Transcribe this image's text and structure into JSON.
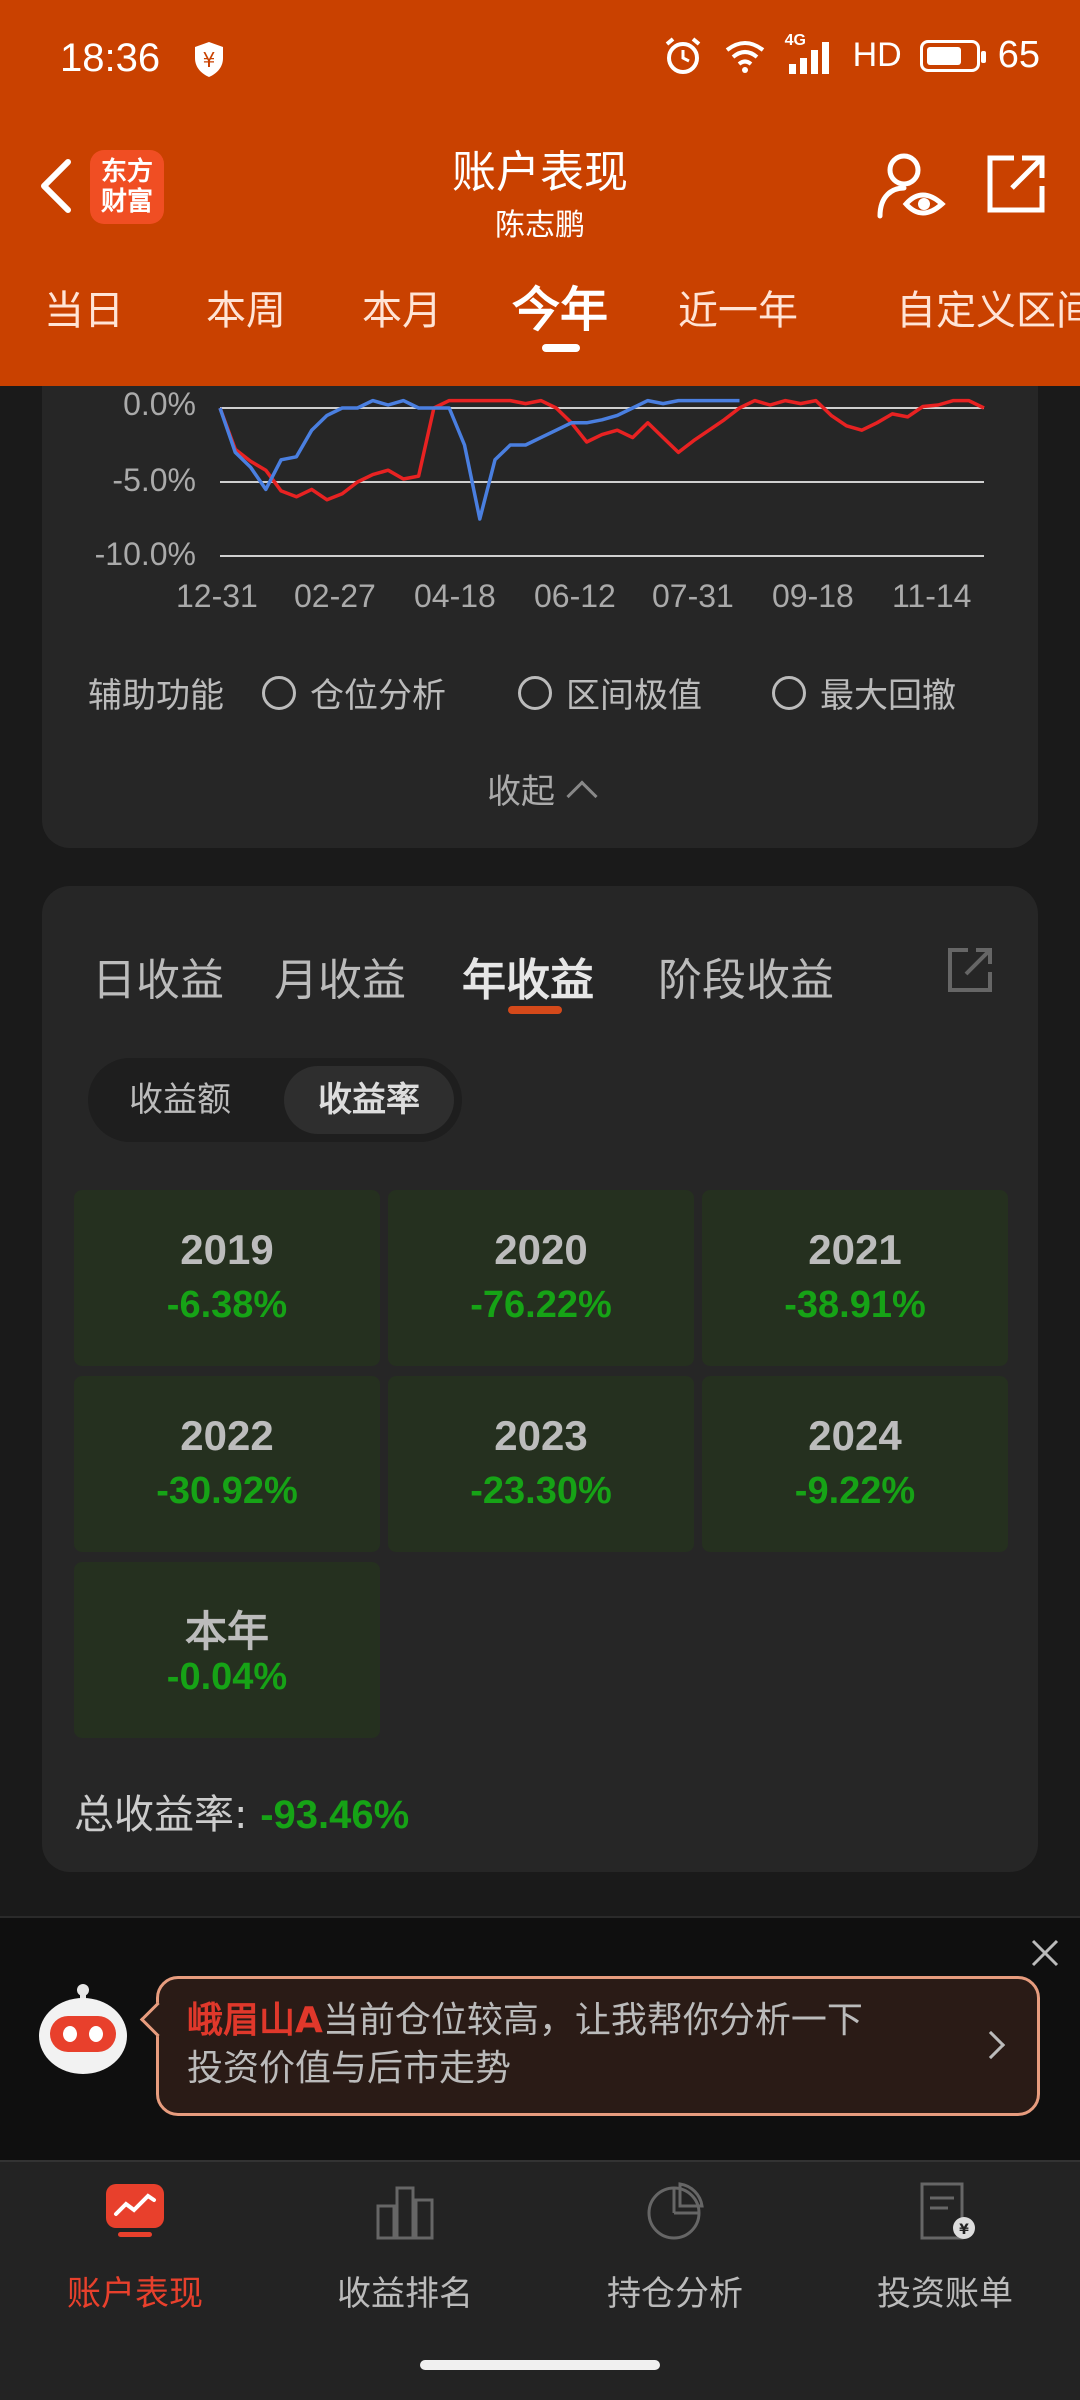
{
  "status_bar": {
    "time": "18:36",
    "network": "4G",
    "hd": "HD",
    "battery": "65"
  },
  "header": {
    "title": "账户表现",
    "subtitle": "陈志鹏",
    "logo": [
      "东方",
      "财富"
    ]
  },
  "period_tabs": [
    "当日",
    "本周",
    "本月",
    "今年",
    "近一年",
    "自定义区间"
  ],
  "period_active": "今年",
  "chart_data": {
    "type": "line",
    "title": "",
    "x_ticks": [
      "12-31",
      "02-27",
      "04-18",
      "06-12",
      "07-31",
      "09-18",
      "11-14"
    ],
    "y_ticks": [
      "0.0%",
      "-5.0%",
      "-10.0%"
    ],
    "ylim": [
      -10,
      0
    ],
    "series": [
      {
        "color": "#e82222",
        "x": [
          0,
          2,
          4,
          6,
          8,
          10,
          12,
          14,
          16,
          18,
          20,
          22,
          24,
          26,
          28,
          30,
          32,
          34,
          36,
          38,
          40,
          42,
          44,
          46,
          48,
          50,
          52,
          54,
          56,
          58,
          60,
          62,
          64,
          66,
          68,
          70,
          72,
          74,
          76,
          78,
          80,
          82,
          84,
          86,
          88,
          90,
          92,
          94,
          96,
          98,
          100
        ],
        "y": [
          0,
          -2.8,
          -3.6,
          -4.2,
          -5.6,
          -6.0,
          -5.5,
          -6.2,
          -5.8,
          -5.0,
          -4.5,
          -4.2,
          -4.8,
          -4.6,
          0,
          0.5,
          0.5,
          0.5,
          0.5,
          0.5,
          0.3,
          0.5,
          0,
          -1.0,
          -2.3,
          -1.8,
          -1.5,
          -2.0,
          -1.0,
          -2.0,
          -3.0,
          -2.2,
          -1.5,
          -0.8,
          0,
          0.5,
          0.2,
          0.5,
          0.3,
          0.5,
          -0.5,
          -1.2,
          -1.5,
          -1.0,
          -0.4,
          -0.6,
          0.1,
          0.2,
          0.5,
          0.5,
          0
        ]
      },
      {
        "color": "#4a7fe0",
        "x": [
          0,
          2,
          4,
          6,
          8,
          10,
          12,
          14,
          16,
          18,
          20,
          22,
          24,
          26,
          28,
          30,
          32,
          34,
          36,
          38,
          40,
          42,
          44,
          46,
          48,
          50,
          52,
          54,
          56,
          58,
          60,
          62,
          64,
          66,
          68
        ],
        "y": [
          0,
          -3.0,
          -4.0,
          -5.5,
          -3.5,
          -3.3,
          -1.5,
          -0.5,
          0,
          0,
          0.5,
          0.2,
          0.5,
          0,
          0,
          0,
          -2.5,
          -7.5,
          -3.5,
          -2.5,
          -2.5,
          -2.0,
          -1.5,
          -1.0,
          -1.0,
          -0.8,
          -0.5,
          0.0,
          0.5,
          0.3,
          0.5,
          0.5,
          0.5,
          0.5,
          0.5
        ]
      }
    ]
  },
  "aux": {
    "label": "辅助功能",
    "options": [
      "仓位分析",
      "区间极值",
      "最大回撤"
    ]
  },
  "collapse_label": "收起",
  "earnings": {
    "tabs": [
      "日收益",
      "月收益",
      "年收益",
      "阶段收益"
    ],
    "active_tab": "年收益",
    "segment": [
      "收益额",
      "收益率"
    ],
    "segment_active": "收益率",
    "years": [
      {
        "year": "2019",
        "rate": "-6.38%"
      },
      {
        "year": "2020",
        "rate": "-76.22%"
      },
      {
        "year": "2021",
        "rate": "-38.91%"
      },
      {
        "year": "2022",
        "rate": "-30.92%"
      },
      {
        "year": "2023",
        "rate": "-23.30%"
      },
      {
        "year": "2024",
        "rate": "-9.22%"
      },
      {
        "year": "本年",
        "rate": "-0.04%"
      }
    ],
    "total_label": "总收益率:",
    "total_value": "-93.46%"
  },
  "promo": {
    "stock": "峨眉山A",
    "line1": "当前仓位较高，让我帮你分析一下",
    "line2": "投资价值与后市走势"
  },
  "bottom_nav": [
    {
      "label": "账户表现",
      "icon": "account-performance-icon",
      "active": true
    },
    {
      "label": "收益排名",
      "icon": "ranking-icon",
      "active": false
    },
    {
      "label": "持仓分析",
      "icon": "pie-chart-icon",
      "active": false
    },
    {
      "label": "投资账单",
      "icon": "bill-icon",
      "active": false
    }
  ]
}
